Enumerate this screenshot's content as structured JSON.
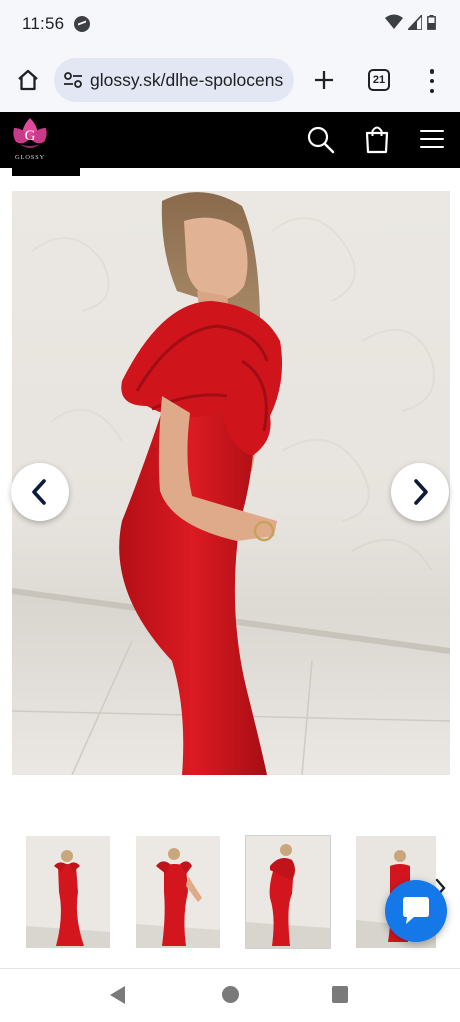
{
  "status_bar": {
    "time": "11:56",
    "icons": [
      "messenger-icon",
      "wifi-icon",
      "signal-icon",
      "battery-icon"
    ]
  },
  "browser": {
    "url": "glossy.sk/dlhe-spolocens",
    "tab_count": "21",
    "icons": [
      "home-icon",
      "site-settings-icon",
      "plus-icon",
      "tabs-icon",
      "more-vert-icon"
    ]
  },
  "site": {
    "logo_letter": "G",
    "logo_text": "GLOSSY",
    "brand_color": "#e04a9c",
    "header_bg": "#000000",
    "icons": [
      "search-icon",
      "shopping-bag-icon",
      "hamburger-menu-icon"
    ]
  },
  "gallery": {
    "main_image": "red-ruffle-sleeve-maxi-dress-model",
    "dress_color": "#d8141c",
    "thumbnail_count": 4,
    "active_thumbnail": 3,
    "icons": [
      "chevron-left-icon",
      "chevron-right-icon"
    ]
  },
  "chat": {
    "button_color": "#1478e8",
    "icon": "chat-bubble-icon"
  },
  "nav": {
    "icons": [
      "back-icon",
      "home-circle-icon",
      "recents-icon"
    ]
  }
}
